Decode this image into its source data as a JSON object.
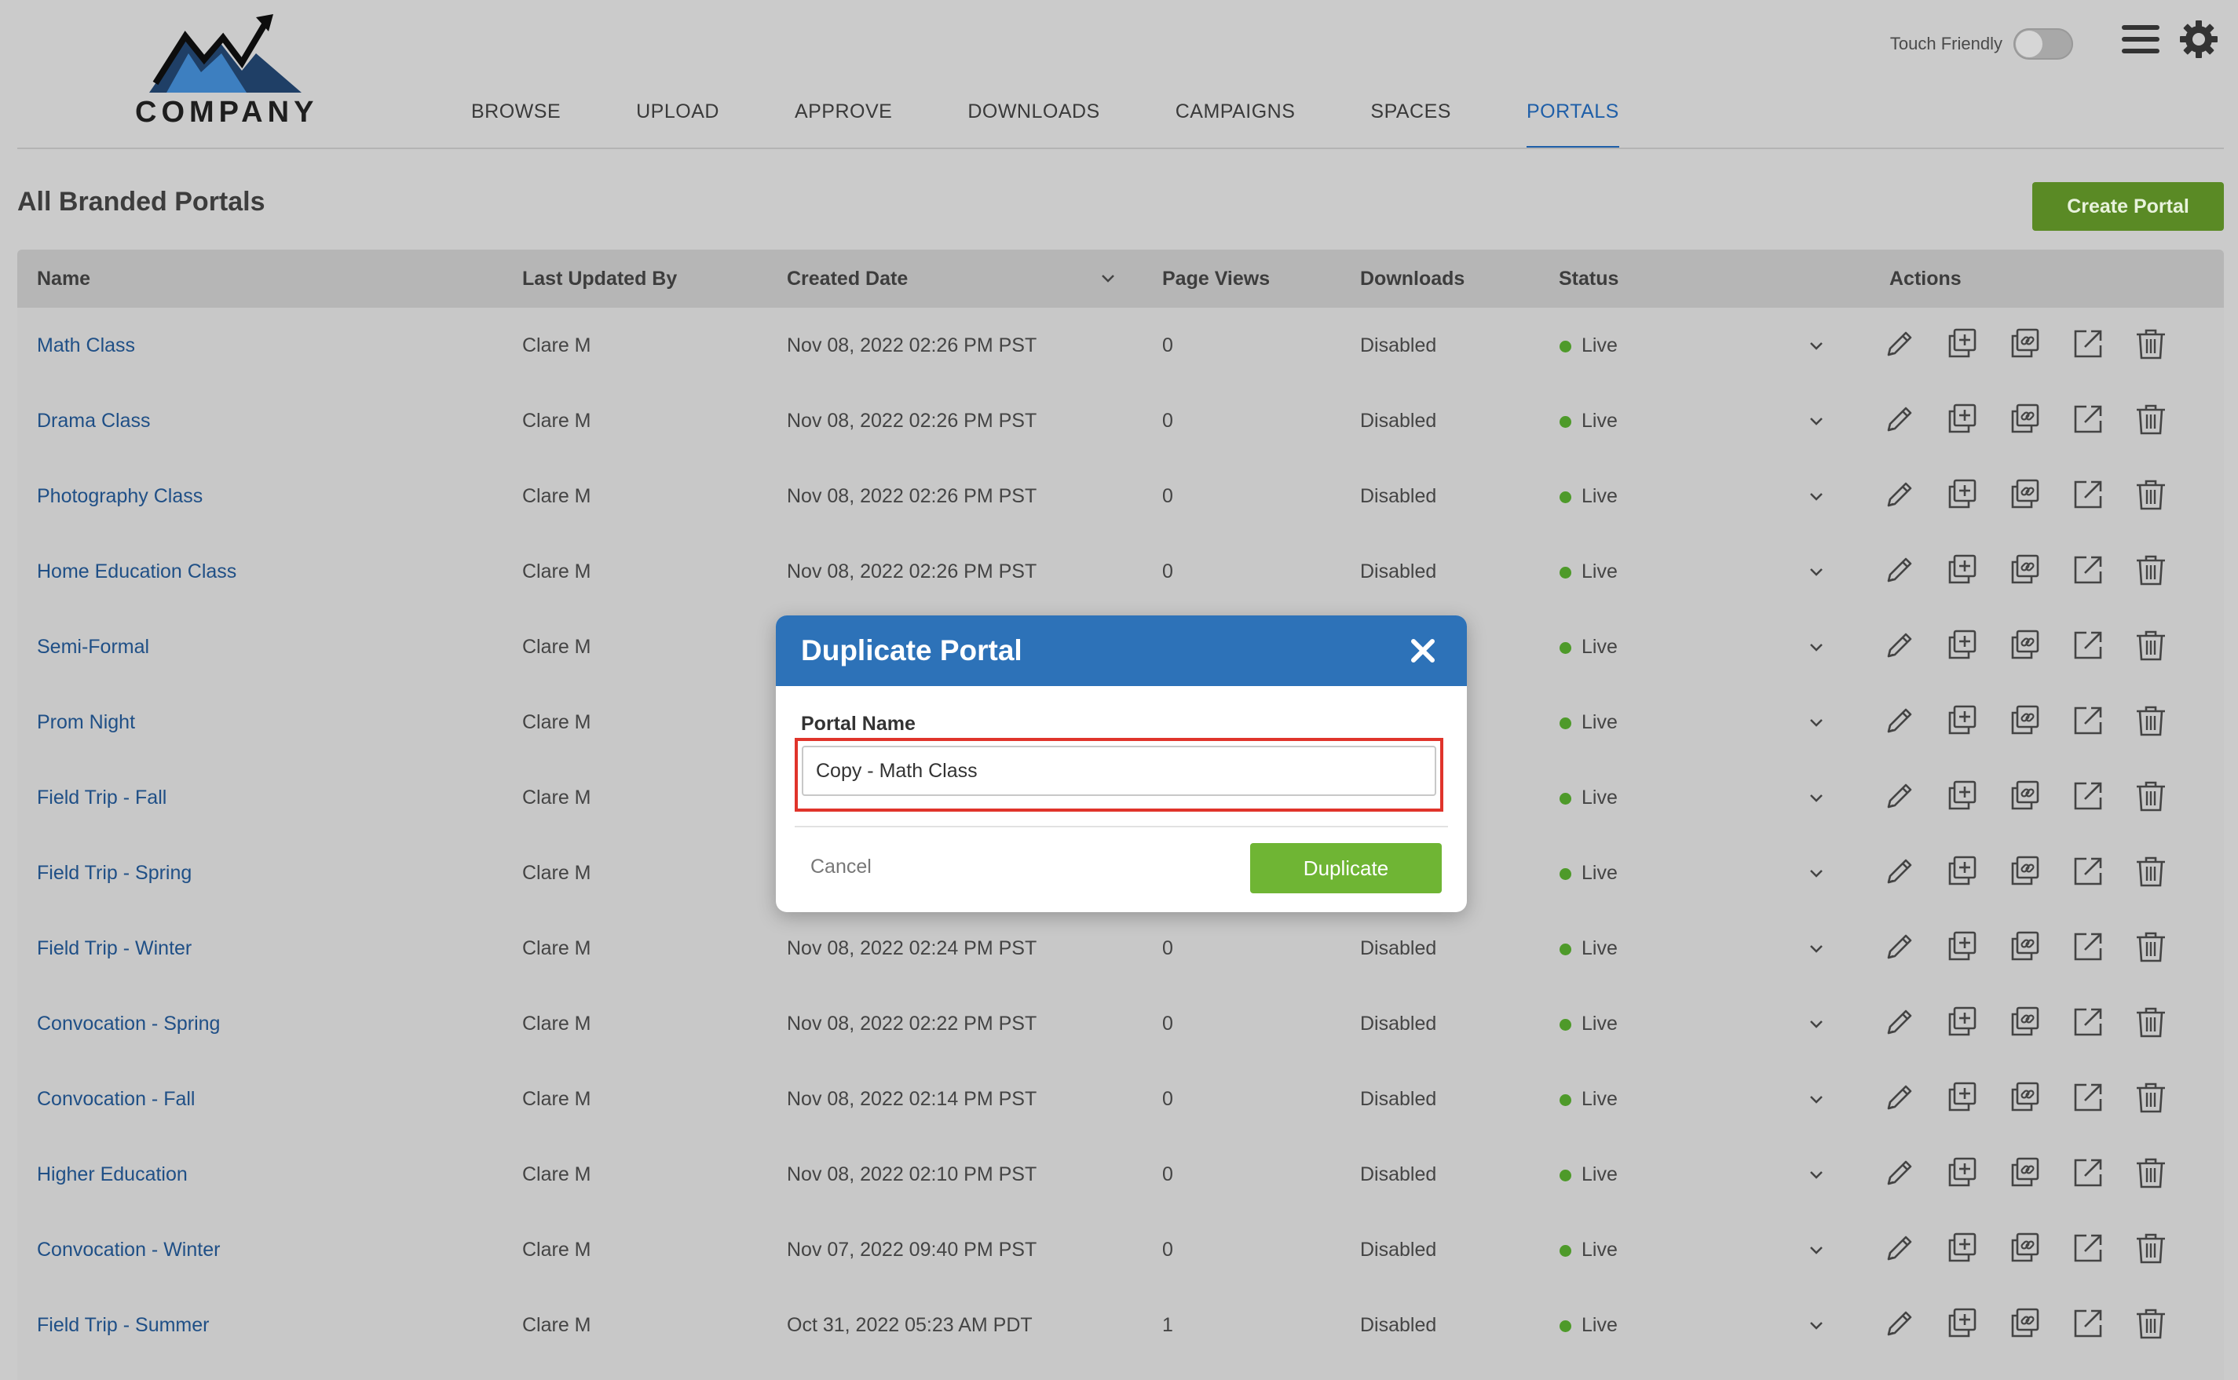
{
  "brand": {
    "name": "COMPANY"
  },
  "nav": [
    "BROWSE",
    "UPLOAD",
    "APPROVE",
    "DOWNLOADS",
    "CAMPAIGNS",
    "SPACES",
    "PORTALS"
  ],
  "nav_active": "PORTALS",
  "header": {
    "touch_label": "Touch Friendly"
  },
  "page": {
    "title": "All Branded Portals",
    "create_label": "Create Portal"
  },
  "table": {
    "columns": [
      "Name",
      "Last Updated By",
      "Created Date",
      "Page Views",
      "Downloads",
      "Status",
      "Actions"
    ],
    "rows": [
      [
        "Math Class",
        "Clare M",
        "Nov 08, 2022 02:26 PM PST",
        "0",
        "Disabled",
        "Live"
      ],
      [
        "Drama Class",
        "Clare M",
        "Nov 08, 2022 02:26 PM PST",
        "0",
        "Disabled",
        "Live"
      ],
      [
        "Photography Class",
        "Clare M",
        "Nov 08, 2022 02:26 PM PST",
        "0",
        "Disabled",
        "Live"
      ],
      [
        "Home Education Class",
        "Clare M",
        "Nov 08, 2022 02:26 PM PST",
        "0",
        "Disabled",
        "Live"
      ],
      [
        "Semi-Formal",
        "Clare M",
        "",
        "",
        "",
        "Live"
      ],
      [
        "Prom Night",
        "Clare M",
        "",
        "",
        "",
        "Live"
      ],
      [
        "Field Trip - Fall",
        "Clare M",
        "",
        "",
        "",
        "Live"
      ],
      [
        "Field Trip - Spring",
        "Clare M",
        "",
        "",
        "",
        "Live"
      ],
      [
        "Field Trip - Winter",
        "Clare M",
        "Nov 08, 2022 02:24 PM PST",
        "0",
        "Disabled",
        "Live"
      ],
      [
        "Convocation - Spring",
        "Clare M",
        "Nov 08, 2022 02:22 PM PST",
        "0",
        "Disabled",
        "Live"
      ],
      [
        "Convocation - Fall",
        "Clare M",
        "Nov 08, 2022 02:14 PM PST",
        "0",
        "Disabled",
        "Live"
      ],
      [
        "Higher Education",
        "Clare M",
        "Nov 08, 2022 02:10 PM PST",
        "0",
        "Disabled",
        "Live"
      ],
      [
        "Convocation - Winter",
        "Clare M",
        "Nov 07, 2022 09:40 PM PST",
        "0",
        "Disabled",
        "Live"
      ],
      [
        "Field Trip - Summer",
        "Clare M",
        "Oct 31, 2022 05:23 AM PDT",
        "1",
        "Disabled",
        "Live"
      ]
    ],
    "action_icons": [
      "pencil-icon",
      "add-copy-icon",
      "link-copy-icon",
      "share-external-icon",
      "trash-icon"
    ]
  },
  "modal": {
    "title": "Duplicate Portal",
    "field_label": "Portal Name",
    "field_value": "Copy - Math Class",
    "cancel_label": "Cancel",
    "confirm_label": "Duplicate"
  },
  "colors": {
    "accent_blue": "#1f5fa8",
    "modal_header": "#2d72b8",
    "create_button": "#5a8a25",
    "duplicate_button": "#6fb534",
    "status_live": "#4e9a2a",
    "highlight_border": "#e0342b"
  }
}
